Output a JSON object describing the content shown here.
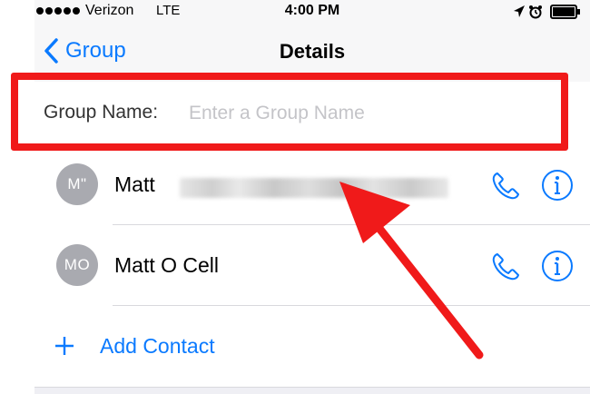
{
  "status_bar": {
    "carrier": "Verizon",
    "network": "LTE",
    "time": "4:00 PM"
  },
  "nav": {
    "back_label": "Group",
    "title": "Details"
  },
  "group": {
    "label": "Group Name:",
    "placeholder": "Enter a Group Name",
    "value": ""
  },
  "contacts": [
    {
      "initials": "M\"",
      "name": "Matt"
    },
    {
      "initials": "MO",
      "name": "Matt O Cell"
    }
  ],
  "add_contact": {
    "label": "Add Contact"
  },
  "colors": {
    "accent": "#0a7aff",
    "annotation": "#f01a1a",
    "avatar": "#a9aab0"
  },
  "icons": {
    "back": "chevron-left-icon",
    "call": "phone-icon",
    "info": "info-icon",
    "add": "plus-icon"
  }
}
